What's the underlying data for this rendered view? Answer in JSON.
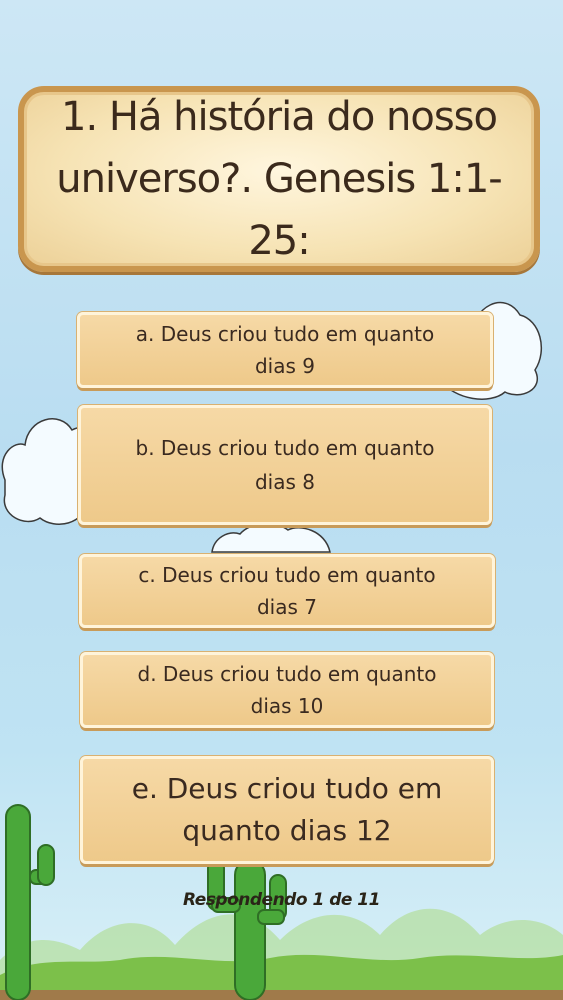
{
  "question": {
    "line1": "1. Há história do nosso",
    "line2": "universo?.  Genesis 1:1-25:"
  },
  "answers": [
    {
      "line1": "a. Deus criou tudo em quanto",
      "line2": "dias 9"
    },
    {
      "line1": "b. Deus criou tudo em quanto",
      "line2": "dias 8"
    },
    {
      "line1": "c. Deus criou tudo em quanto",
      "line2": "dias 7"
    },
    {
      "line1": "d. Deus criou tudo em quanto",
      "line2": "dias 10"
    },
    {
      "line1": "e. Deus criou tudo em",
      "line2": "quanto dias 12"
    }
  ],
  "progress": "Respondendo 1 de 11",
  "colors": {
    "sky": "#bfe3f3",
    "card_border": "#c9964e",
    "button": "#f0cd91",
    "grass": "#7cc04a",
    "cactus": "#4aa83a"
  }
}
